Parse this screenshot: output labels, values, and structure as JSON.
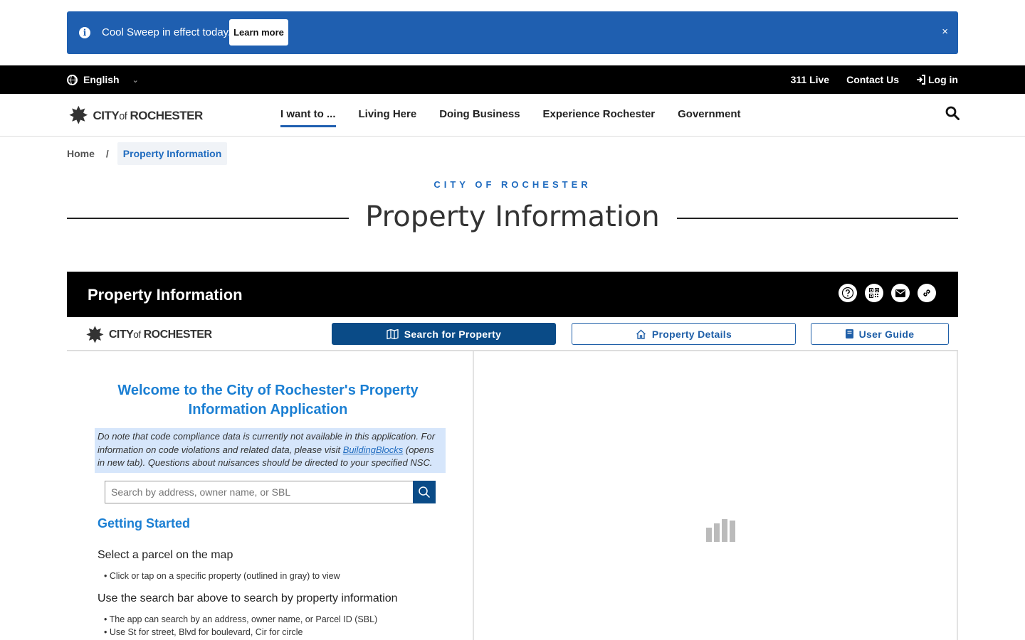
{
  "alert": {
    "message": "Cool Sweep in effect today.",
    "learn_more": "Learn more",
    "close": "×",
    "info_glyph": "i"
  },
  "topbar": {
    "language": "English",
    "links": [
      "311 Live",
      "Contact Us",
      "Log in"
    ]
  },
  "site_logo": {
    "city": "CITY",
    "of": "of",
    "name": "ROCHESTER"
  },
  "nav": {
    "items": [
      "I want to ...",
      "Living Here",
      "Doing Business",
      "Experience Rochester",
      "Government"
    ]
  },
  "breadcrumb": {
    "home": "Home",
    "separator": "/",
    "current": "Property Information"
  },
  "page": {
    "kicker": "CITY OF ROCHESTER",
    "title": "Property Information"
  },
  "app": {
    "title": "Property Information",
    "toolbar_icons": [
      "help-icon",
      "qr-code-icon",
      "email-icon",
      "link-icon"
    ],
    "buttons": {
      "search": "Search for Property",
      "details": "Property Details",
      "guide": "User Guide"
    },
    "welcome": "Welcome to the City of Rochester's Property Information Application",
    "notice": {
      "before": "Do note that code compliance data is currently not available in this application. For information on code violations and related data, please visit ",
      "link": "BuildingBlocks",
      "after": " (opens in new tab). Questions about nuisances should be directed to your specified NSC."
    },
    "search_placeholder": "Search by address, owner name, or SBL",
    "getting_started": "Getting Started",
    "sections": [
      {
        "heading": "Select a parcel on the map",
        "bullets": [
          "Click or tap on a specific property (outlined in gray) to view"
        ]
      },
      {
        "heading": "Use the search bar above to search by property information",
        "bullets": [
          "The app can search by an address, owner name, or Parcel ID (SBL)",
          "Use St for street, Blvd for boulevard, Cir for circle"
        ]
      }
    ]
  },
  "colors": {
    "alert_bg": "#1f5fb0",
    "accent": "#1b7fd3",
    "primary_button": "#0a4b87",
    "notice_bg": "#d6e6fb"
  }
}
